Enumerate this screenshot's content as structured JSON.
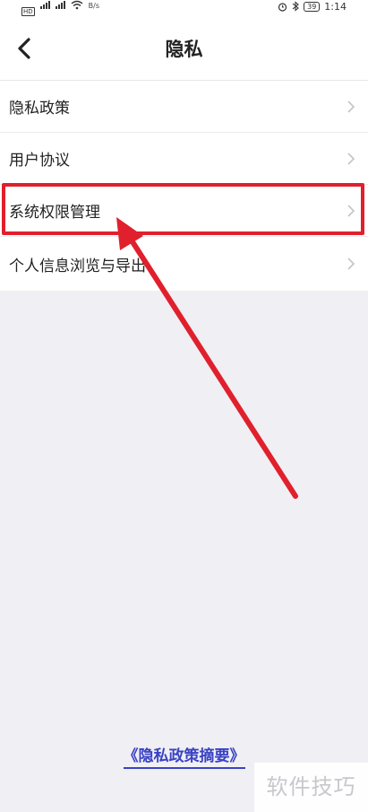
{
  "status_bar": {
    "network_label": "HD",
    "speed_value": "B/s",
    "battery": "39",
    "time": "1:14"
  },
  "nav": {
    "title": "隐私"
  },
  "list": {
    "items": [
      {
        "label": "隐私政策"
      },
      {
        "label": "用户协议"
      },
      {
        "label": "系统权限管理",
        "highlighted": true
      },
      {
        "label": "个人信息浏览与导出"
      }
    ]
  },
  "footer": {
    "link_text": "《隐私政策摘要》"
  },
  "watermark": {
    "text": "软件技巧"
  },
  "colors": {
    "highlight": "#e0202c",
    "link": "#3a42c4",
    "background": "#efeff4"
  }
}
